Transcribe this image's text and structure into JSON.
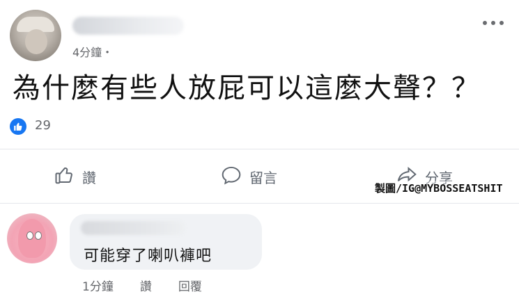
{
  "post": {
    "time": "4分鐘・",
    "text": "為什麼有些人放屁可以這麼大聲？？",
    "reaction_count": "29"
  },
  "actions": {
    "like": "讚",
    "comment": "留言",
    "share": "分享"
  },
  "watermark": "製圖/IG@MYBOSSEATSHIT",
  "comment": {
    "text": "可能穿了喇叭褲吧",
    "time": "1分鐘",
    "like": "讚",
    "reply": "回覆"
  },
  "colors": {
    "accent": "#1877f2",
    "muted_text": "#65676b",
    "bubble": "#f0f2f5"
  }
}
